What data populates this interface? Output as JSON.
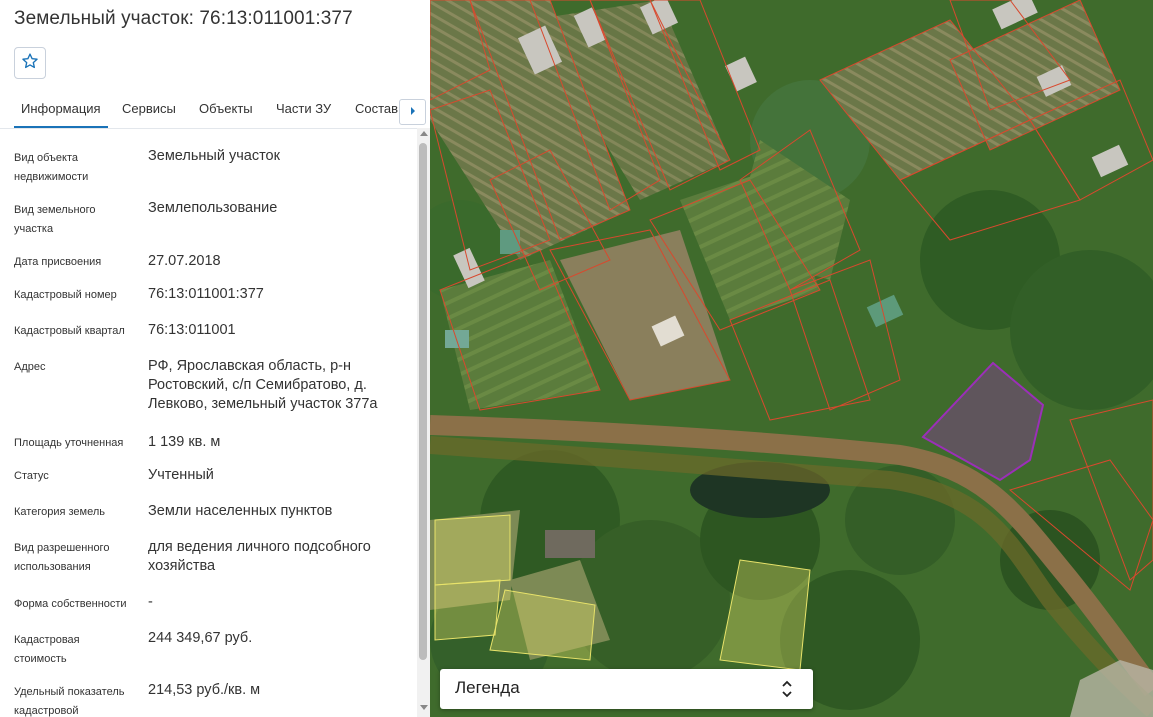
{
  "header": {
    "title": "Земельный участок: 76:13:011001:377"
  },
  "tabs": [
    {
      "label": "Информация",
      "active": true
    },
    {
      "label": "Сервисы"
    },
    {
      "label": "Объекты"
    },
    {
      "label": "Части ЗУ"
    },
    {
      "label": "Состав"
    }
  ],
  "info_rows": [
    {
      "label": "Вид объекта недвижимости",
      "value": "Земельный участок"
    },
    {
      "label": "Вид земельного участка",
      "value": "Землепользование"
    },
    {
      "label": "Дата присвоения",
      "value": "27.07.2018"
    },
    {
      "label": "Кадастровый номер",
      "value": "76:13:011001:377"
    },
    {
      "label": "Кадастровый квартал",
      "value": "76:13:011001"
    },
    {
      "label": "Адрес",
      "value": "РФ, Ярославская область, р-н Ростовский, с/п Семибратово, д. Левково, земельный участок 377а"
    },
    {
      "label": "Площадь уточненная",
      "value": "1 139 кв. м"
    },
    {
      "label": "Статус",
      "value": "Учтенный"
    },
    {
      "label": "Категория земель",
      "value": "Земли населенных пунктов"
    },
    {
      "label": "Вид разрешенного использования",
      "value": "для ведения личного подсобного хозяйства"
    },
    {
      "label": "Форма собственности",
      "value": "-"
    },
    {
      "label": "Кадастровая стоимость",
      "value": "244 349,67 руб."
    },
    {
      "label": "Удельный показатель кадастровой",
      "value": "214,53 руб./кв. м"
    }
  ],
  "map": {
    "legend_label": "Легенда",
    "colors": {
      "parcel_border": "#d8492e",
      "selected_parcel": "#9b2fb8",
      "yellow_parcel": "#e8e36a",
      "road": "#8b7048",
      "vegetation": "#3f6b2c"
    }
  },
  "icons": {
    "favorite": "star-icon",
    "tabs_next": "chevron-right-icon",
    "legend_toggle": "updown-chevron-icon"
  },
  "colors": {
    "accent": "#1a73b8",
    "text": "#333333"
  }
}
